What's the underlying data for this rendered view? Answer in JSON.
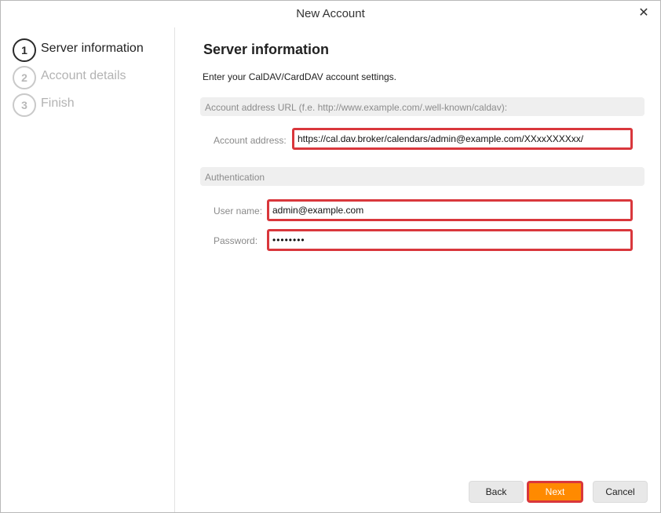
{
  "window": {
    "title": "New Account",
    "close_icon": "close-icon"
  },
  "sidebar": {
    "steps": [
      {
        "number": "1",
        "label": "Server information",
        "active": true
      },
      {
        "number": "2",
        "label": "Account details",
        "active": false
      },
      {
        "number": "3",
        "label": "Finish",
        "active": false
      }
    ]
  },
  "main": {
    "heading": "Server information",
    "subheading": "Enter your CalDAV/CardDAV account settings.",
    "account_section": {
      "title": "Account address URL (f.e. http://www.example.com/.well-known/caldav):",
      "address_label": "Account address:",
      "address_value": "https://cal.dav.broker/calendars/admin@example.com/XXxxXXXXxx/"
    },
    "auth_section": {
      "title": "Authentication",
      "username_label": "User name:",
      "username_value": "admin@example.com",
      "password_label": "Password:",
      "password_value": "••••••••"
    }
  },
  "buttons": {
    "back": "Back",
    "next": "Next",
    "cancel": "Cancel"
  },
  "colors": {
    "highlight_border": "#d9373c",
    "next_button": "#ff8a00",
    "section_bar": "#efefef"
  }
}
